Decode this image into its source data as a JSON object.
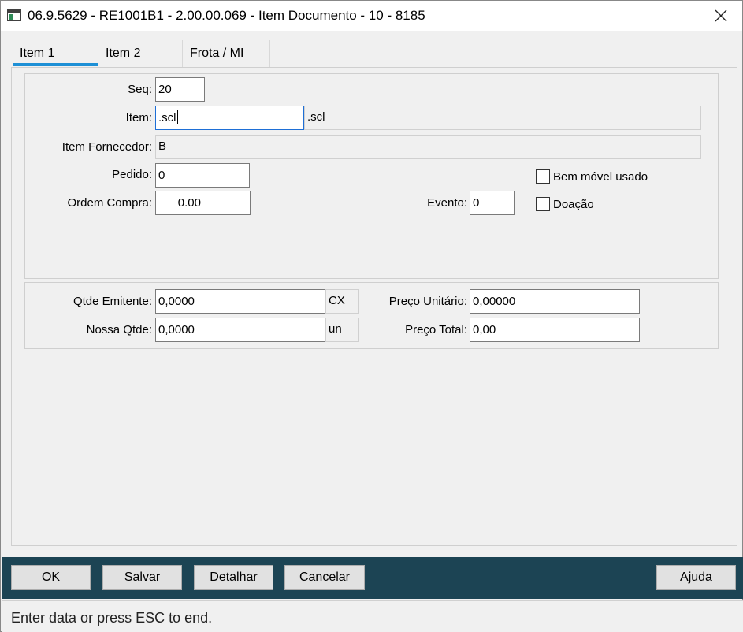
{
  "window": {
    "title": "06.9.5629 - RE1001B1 - 2.00.00.069 - Item Documento - 10 - 8185",
    "close_icon": "close-icon"
  },
  "tabs": [
    {
      "label": "Item 1",
      "active": true
    },
    {
      "label": "Item 2",
      "active": false
    },
    {
      "label": "Frota / MI",
      "active": false
    }
  ],
  "form": {
    "seq": {
      "label": "Seq:",
      "value": "20"
    },
    "item": {
      "label": "Item:",
      "value": ".scl",
      "description": ".scl"
    },
    "item_fornecedor": {
      "label": "Item Fornecedor:",
      "value": "B"
    },
    "pedido": {
      "label": "Pedido:",
      "value": "0"
    },
    "ordem_compra": {
      "label": "Ordem Compra:",
      "value": "0.00"
    },
    "evento": {
      "label": "Evento:",
      "value": "0"
    },
    "bem_movel_usado": {
      "label": "Bem móvel usado",
      "checked": false
    },
    "doacao": {
      "label": "Doação",
      "checked": false
    }
  },
  "quantities": {
    "qtde_emitente": {
      "label": "Qtde Emitente:",
      "value": "0,0000",
      "unit": "CX"
    },
    "nossa_qtde": {
      "label": "Nossa Qtde:",
      "value": "0,0000",
      "unit": "un"
    },
    "preco_unitario": {
      "label": "Preço Unitário:",
      "value": "0,00000"
    },
    "preco_total": {
      "label": "Preço Total:",
      "value": "0,00"
    }
  },
  "buttons": {
    "ok": {
      "underline": "O",
      "rest": "K"
    },
    "salvar": {
      "underline": "S",
      "rest": "alvar"
    },
    "detalhar": {
      "underline": "D",
      "rest": "etalhar"
    },
    "cancelar": {
      "underline": "C",
      "rest": "ancelar"
    },
    "ajuda": "Ajuda"
  },
  "status": {
    "text": "Enter data or press ESC to end."
  },
  "colors": {
    "button_bar": "#1c4454",
    "tab_accent": "#1e90d6",
    "focus_border": "#1e6fd6"
  }
}
